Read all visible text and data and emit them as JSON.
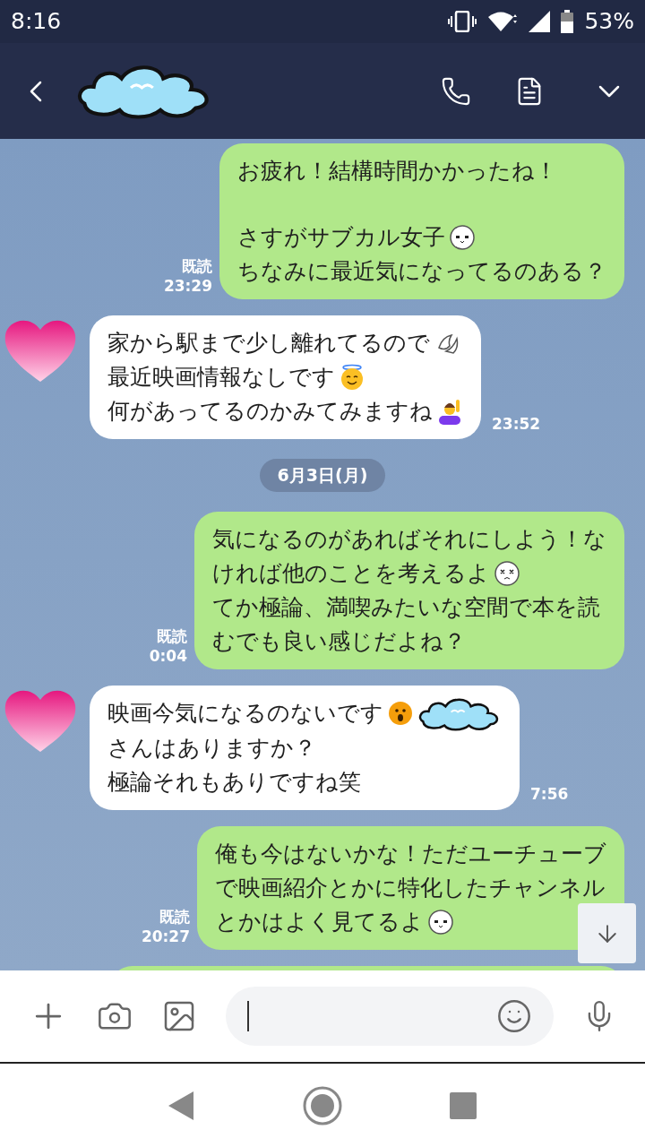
{
  "status_bar": {
    "time": "8:16",
    "battery": "53%"
  },
  "messages": [
    {
      "kind": "sent",
      "read": "既読",
      "time": "23:29",
      "paragraphs": [
        [
          [
            {
              "kind": "text",
              "text": "お疲れ！結構時間かかったね！"
            }
          ]
        ],
        [
          [
            {
              "kind": "text",
              "text": "さすがサブカル女子"
            },
            {
              "kind": "plain_face"
            }
          ],
          [
            {
              "kind": "text",
              "text": "ちなみに最近気になってるのある？"
            }
          ]
        ]
      ]
    },
    {
      "kind": "received",
      "time": "23:52",
      "paragraphs": [
        [
          [
            {
              "kind": "text",
              "text": "家から駅まで少し離れてるので"
            },
            {
              "kind": "sweat"
            }
          ],
          [
            {
              "kind": "text",
              "text": "最近映画情報なしです"
            },
            {
              "kind": "halo_face"
            }
          ],
          [
            {
              "kind": "text",
              "text": "何があってるのかみてみますね"
            },
            {
              "kind": "raised_hand"
            }
          ]
        ]
      ]
    },
    {
      "kind": "date",
      "label": "6月3日(月)"
    },
    {
      "kind": "sent",
      "read": "既読",
      "time": "0:04",
      "paragraphs": [
        [
          [
            {
              "kind": "text",
              "text": "気になるのがあればそれにしよう！な"
            }
          ],
          [
            {
              "kind": "text",
              "text": "ければ他のことを考えるよ"
            },
            {
              "kind": "dizzy_face"
            }
          ],
          [
            {
              "kind": "text",
              "text": "てか極論、満喫みたいな空間で本を読"
            }
          ],
          [
            {
              "kind": "text",
              "text": "むでも良い感じだよね？"
            }
          ]
        ]
      ]
    },
    {
      "kind": "received",
      "time": "7:56",
      "paragraphs": [
        [
          [
            {
              "kind": "text",
              "text": "映画今気になるのないです"
            },
            {
              "kind": "surprised_face"
            },
            {
              "kind": "cloud"
            }
          ],
          [
            {
              "kind": "text",
              "text": "さんはありますか？"
            }
          ],
          [
            {
              "kind": "text",
              "text": "極論それもありですね笑"
            }
          ]
        ]
      ]
    },
    {
      "kind": "sent",
      "read": "既読",
      "time": "20:27",
      "paragraphs": [
        [
          [
            {
              "kind": "text",
              "text": "俺も今はないかな！ただユーチューブ"
            }
          ],
          [
            {
              "kind": "text",
              "text": "で映画紹介とかに特化したチャンネル"
            }
          ],
          [
            {
              "kind": "text",
              "text": "とかはよく見てるよ"
            },
            {
              "kind": "plain_face"
            }
          ]
        ]
      ]
    },
    {
      "kind": "sent_partial"
    }
  ]
}
